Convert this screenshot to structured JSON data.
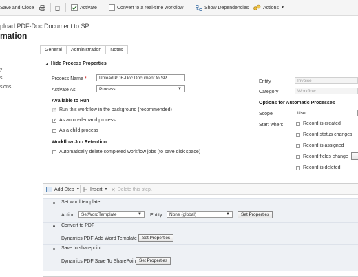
{
  "toolbar": {
    "save_close": "Save and Close",
    "activate": "Activate",
    "convert": "Convert to a real-time workflow",
    "show_dependencies": "Show Dependencies",
    "actions": "Actions"
  },
  "header": {
    "subtitle": "pload PDF-Doc Document to SP",
    "title": "mation"
  },
  "leftnav": [
    "y",
    "s",
    "sions"
  ],
  "tabs": [
    "General",
    "Administration",
    "Notes"
  ],
  "properties": {
    "section_title": "Hide Process Properties",
    "process_name_label": "Process Name",
    "required_mark": "*",
    "process_name_value": "Upload PDF-Doc Document to SP",
    "activate_as_label": "Activate As",
    "activate_as_value": "Process",
    "available_title": "Available to Run",
    "options": [
      {
        "label": "Run this workflow in the background (recommended)",
        "checked": true,
        "disabled": true
      },
      {
        "label": "As an on-demand process",
        "checked": true,
        "disabled": false
      },
      {
        "label": "As a child process",
        "checked": false,
        "disabled": false
      }
    ],
    "retention_title": "Workflow Job Retention",
    "retention_option": {
      "label": "Automatically delete completed workflow jobs (to save disk space)",
      "checked": false
    }
  },
  "right": {
    "entity_label": "Entity",
    "entity_value": "Invoice",
    "category_label": "Category",
    "category_value": "Workflow",
    "auto_title": "Options for Automatic Processes",
    "scope_label": "Scope",
    "scope_value": "User",
    "start_when_label": "Start when:",
    "start_options": [
      {
        "label": "Record is created",
        "checked": false
      },
      {
        "label": "Record status changes",
        "checked": false
      },
      {
        "label": "Record is assigned",
        "checked": false
      },
      {
        "label": "Record fields change",
        "checked": false
      },
      {
        "label": "Record is deleted",
        "checked": false
      }
    ]
  },
  "steps_toolbar": {
    "add_step": "Add Step",
    "insert": "Insert",
    "delete": "Delete this step."
  },
  "steps": [
    {
      "title": "Set word template",
      "action_label": "Action",
      "action_value": "SetWordTemplate",
      "entity_label": "Entity",
      "entity_value": "None (global)",
      "button": "Set Properties"
    },
    {
      "title": "Convert to PDF",
      "detail": "Dynamics PDF:Add Word Template",
      "button": "Set Properties"
    },
    {
      "title": "Save to sharepoint",
      "detail": "Dynamics PDF:Save To SharePoint",
      "button": "Set Properties"
    }
  ]
}
